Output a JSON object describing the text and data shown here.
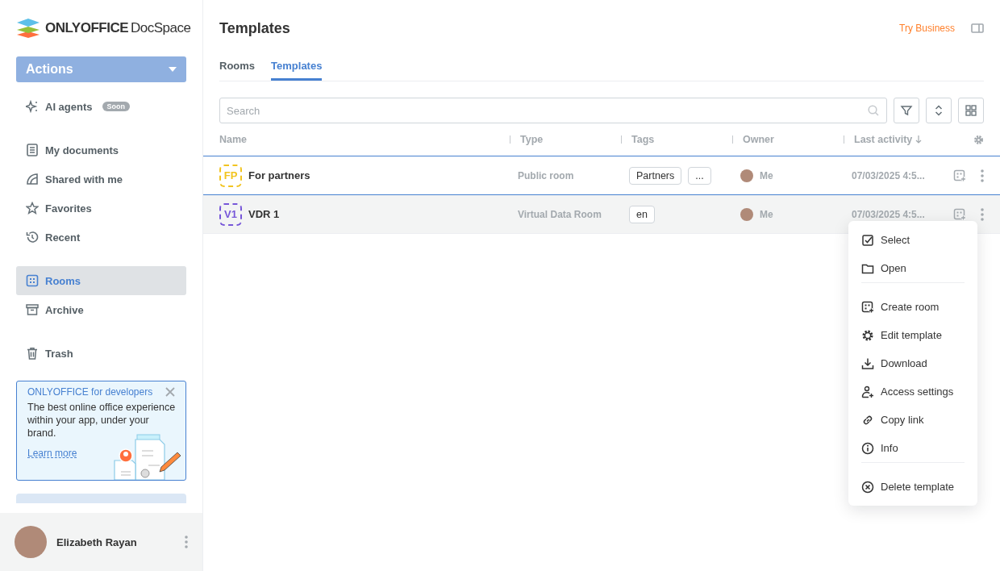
{
  "logo": {
    "brand": "ONLYOFFICE",
    "product": "DocSpace"
  },
  "actions_button": {
    "label": "Actions"
  },
  "sidebar": {
    "groups": [
      [
        {
          "label": "AI agents",
          "badge": "Soon",
          "selected": false
        }
      ],
      [
        {
          "label": "My documents",
          "selected": false
        },
        {
          "label": "Shared with me",
          "selected": false
        },
        {
          "label": "Favorites",
          "selected": false
        },
        {
          "label": "Recent",
          "selected": false
        }
      ],
      [
        {
          "label": "Rooms",
          "selected": true
        },
        {
          "label": "Archive",
          "selected": false
        }
      ],
      [
        {
          "label": "Trash",
          "selected": false
        }
      ]
    ]
  },
  "promo": {
    "title": "ONLYOFFICE for developers",
    "text": "The best online office experience within your app, under your brand.",
    "link": "Learn more"
  },
  "user": {
    "name": "Elizabeth Rayan"
  },
  "header": {
    "title": "Templates",
    "try_business": "Try Business"
  },
  "tabs": [
    {
      "label": "Rooms",
      "selected": false
    },
    {
      "label": "Templates",
      "selected": true
    }
  ],
  "search": {
    "placeholder": "Search"
  },
  "table": {
    "columns": [
      "Name",
      "Type",
      "Tags",
      "Owner",
      "Last activity"
    ],
    "rows": [
      {
        "initials": "FP",
        "color": "#f2c420",
        "name": "For partners",
        "type": "Public room",
        "tags": [
          "Partners",
          "..."
        ],
        "owner": "Me",
        "last_activity": "07/03/2025 4:5...",
        "focused": true,
        "selected": false
      },
      {
        "initials": "V1",
        "color": "#7757d9",
        "name": "VDR 1",
        "type": "Virtual Data Room",
        "tags": [
          "en"
        ],
        "owner": "Me",
        "last_activity": "07/03/2025 4:5...",
        "focused": false,
        "selected": true
      }
    ]
  },
  "context_menu": {
    "items": [
      {
        "label": "Select",
        "separator_before": false
      },
      {
        "label": "Open",
        "separator_before": false
      },
      {
        "label": "Create room",
        "separator_before": true
      },
      {
        "label": "Edit template",
        "separator_before": false
      },
      {
        "label": "Download",
        "separator_before": false
      },
      {
        "label": "Access settings",
        "separator_before": false
      },
      {
        "label": "Copy link",
        "separator_before": false
      },
      {
        "label": "Info",
        "separator_before": false
      },
      {
        "label": "Delete template",
        "separator_before": true
      }
    ]
  }
}
